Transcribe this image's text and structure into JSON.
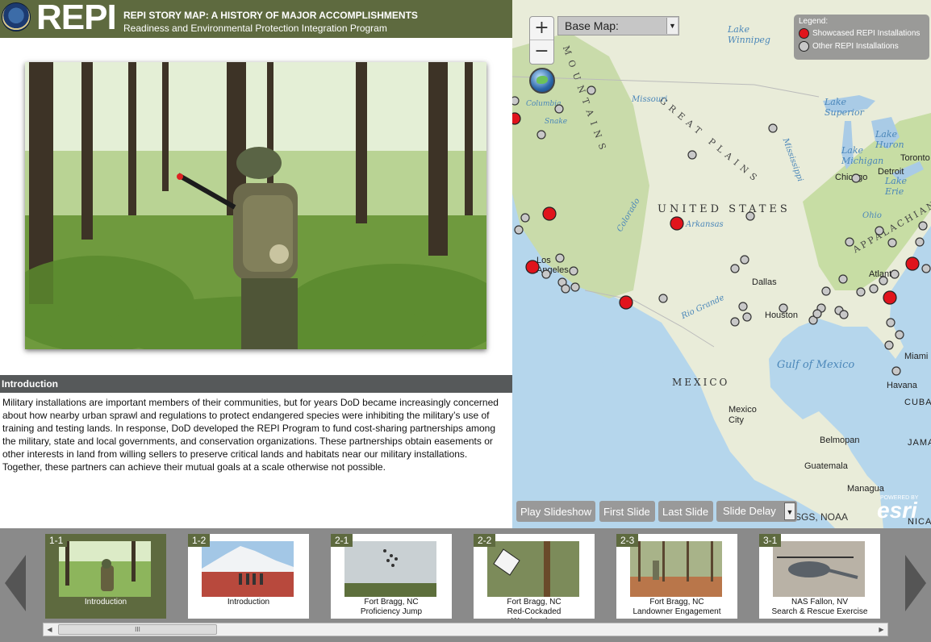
{
  "header": {
    "brand": "REPI",
    "title": "REPI STORY MAP: A HISTORY OF MAJOR ACCOMPLISHMENTS",
    "subtitle": "Readiness and Environmental Protection Integration Program"
  },
  "intro": {
    "heading": "Introduction",
    "body": "Military installations are important members of their communities, but for years DoD became increasingly concerned about how nearby urban sprawl and regulations to protect endangered species were inhibiting the military’s use of training and testing lands. In response, DoD developed the REPI Program to fund cost-sharing partnerships among the military, state and local governments, and conservation organizations. These partnerships obtain easements or other interests in land from willing sellers to preserve critical lands and habitats near our military installations. Together, these partners can achieve their mutual goals at a scale otherwise not possible."
  },
  "map": {
    "zoom_in": "+",
    "zoom_out": "−",
    "basemap_label": "Base Map:",
    "legend": {
      "title": "Legend:",
      "items": [
        {
          "label": "Showcased REPI Installations",
          "color": "#e0141c"
        },
        {
          "label": "Other REPI Installations",
          "color": "#c8c8c8"
        }
      ]
    },
    "labels": {
      "united_states": "UNITED STATES",
      "great_plains": "GREAT PLAINS",
      "mountains": "M O U N T A I N S",
      "appalachian": "APPALACHIAN",
      "mexico": "MEXICO",
      "gulf": "Gulf of Mexico",
      "lake_winnipeg": "Lake Winnipeg",
      "lake_superior": "Lake Superior",
      "lake_michigan": "Lake Michigan",
      "lake_huron": "Lake Huron",
      "lake_erie": "Lake Erie",
      "missouri": "Missouri",
      "mississippi": "Mississippi",
      "arkansas": "Arkansas",
      "rio_grande": "Rio Grande",
      "colorado": "Colorado",
      "ohio": "Ohio",
      "columbia": "Columbia",
      "snake": "Snake",
      "toronto": "Toronto",
      "detroit": "Detroit",
      "chicago": "Chicago",
      "los_angeles": "Los Angeles",
      "dallas": "Dallas",
      "houston": "Houston",
      "atlanta": "Atlanta",
      "miami": "Miami",
      "havana": "Havana",
      "cuba": "CUBA",
      "mexico_city": "Mexico City",
      "belmopan": "Belmopan",
      "guatemala": "Guatemala",
      "managua": "Managua",
      "jama": "JAMA",
      "nica": "NICA"
    },
    "buttons": {
      "play": "Play Slideshow",
      "first": "First Slide",
      "last": "Last Slide",
      "delay": "Slide Delay"
    },
    "attribution": "SGS, NOAA",
    "esri_powered": "POWERED BY",
    "esri": "esri"
  },
  "slides": [
    {
      "num": "1-1",
      "caption": "Introduction",
      "active": true
    },
    {
      "num": "1-2",
      "caption": "Introduction",
      "active": false
    },
    {
      "num": "2-1",
      "caption": "Fort Bragg, NC\nProficiency Jump",
      "active": false
    },
    {
      "num": "2-2",
      "caption": "Fort Bragg, NC\nRed-Cockaded\nWoodpecker",
      "active": false
    },
    {
      "num": "2-3",
      "caption": "Fort Bragg, NC\nLandowner Engagement",
      "active": false
    },
    {
      "num": "3-1",
      "caption": "NAS Fallon, NV\nSearch & Rescue Exercise",
      "active": false
    }
  ],
  "scrollbar_grip": "III",
  "colors": {
    "header_olive": "#5e6a3f",
    "intro_bar": "#56595a",
    "showcased": "#e0141c",
    "other": "#c8c8c8",
    "carousel_bg": "#8a8a8a"
  }
}
